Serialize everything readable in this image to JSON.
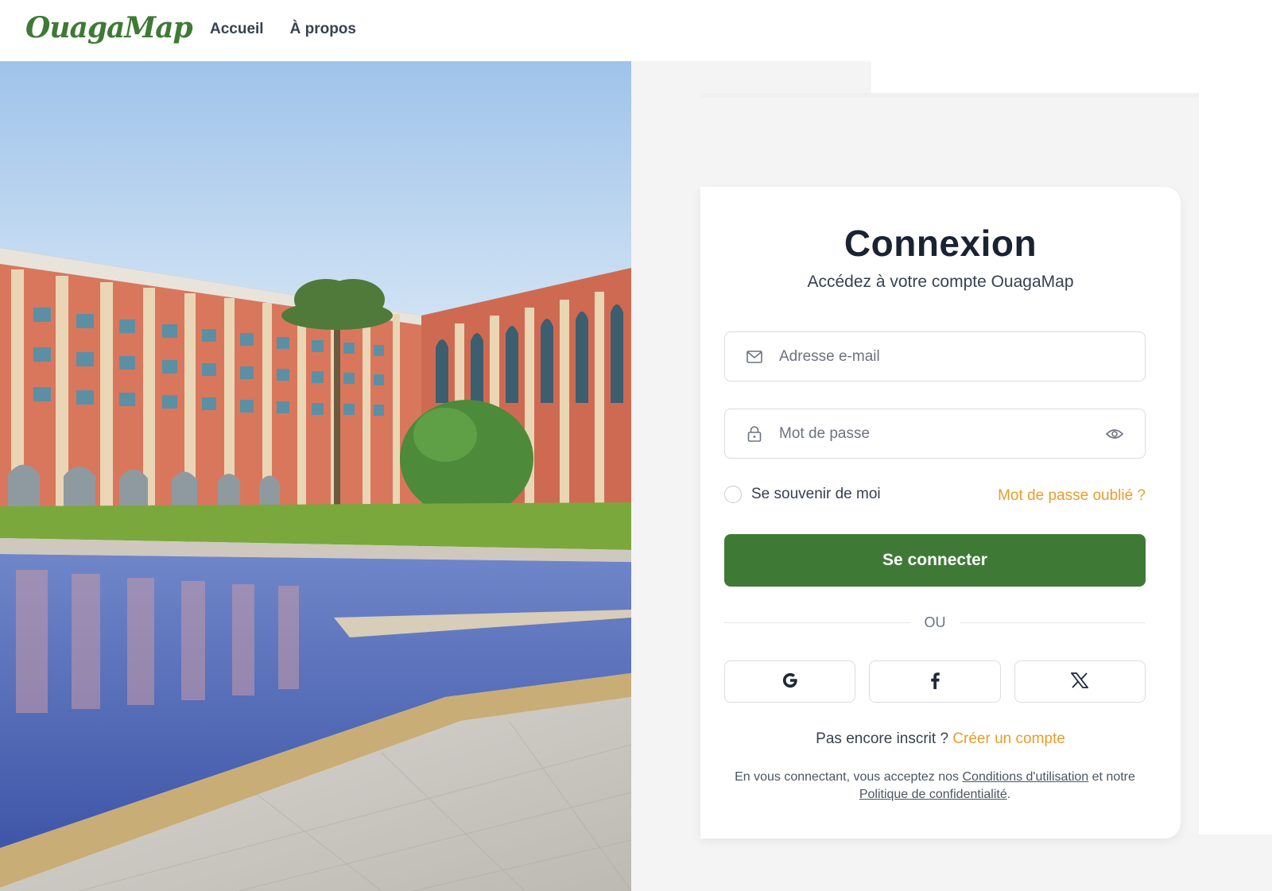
{
  "header": {
    "logo": "OuagaMap",
    "nav": [
      {
        "label": "Accueil"
      },
      {
        "label": "À propos"
      }
    ]
  },
  "login": {
    "title": "Connexion",
    "subtitle": "Accédez à votre compte OuagaMap",
    "email_placeholder": "Adresse e-mail",
    "password_placeholder": "Mot de passe",
    "remember_label": "Se souvenir de moi",
    "forgot_label": "Mot de passe oublié ?",
    "submit_label": "Se connecter",
    "divider_label": "OU",
    "signup_prompt": "Pas encore inscrit ?",
    "signup_link": "Créer un compte",
    "legal_prefix": "En vous connectant, vous acceptez nos",
    "terms_link": "Conditions d'utilisation",
    "legal_middle": "et notre",
    "privacy_link": "Politique de confidentialité",
    "legal_suffix": "."
  },
  "colors": {
    "brand_green": "#3e7a35",
    "accent_orange": "#e99d2a"
  },
  "icons": {
    "email": "mail-icon",
    "password": "lock-icon",
    "toggle_password": "eye-icon",
    "socials": [
      "google-icon",
      "facebook-icon",
      "x-icon"
    ]
  }
}
